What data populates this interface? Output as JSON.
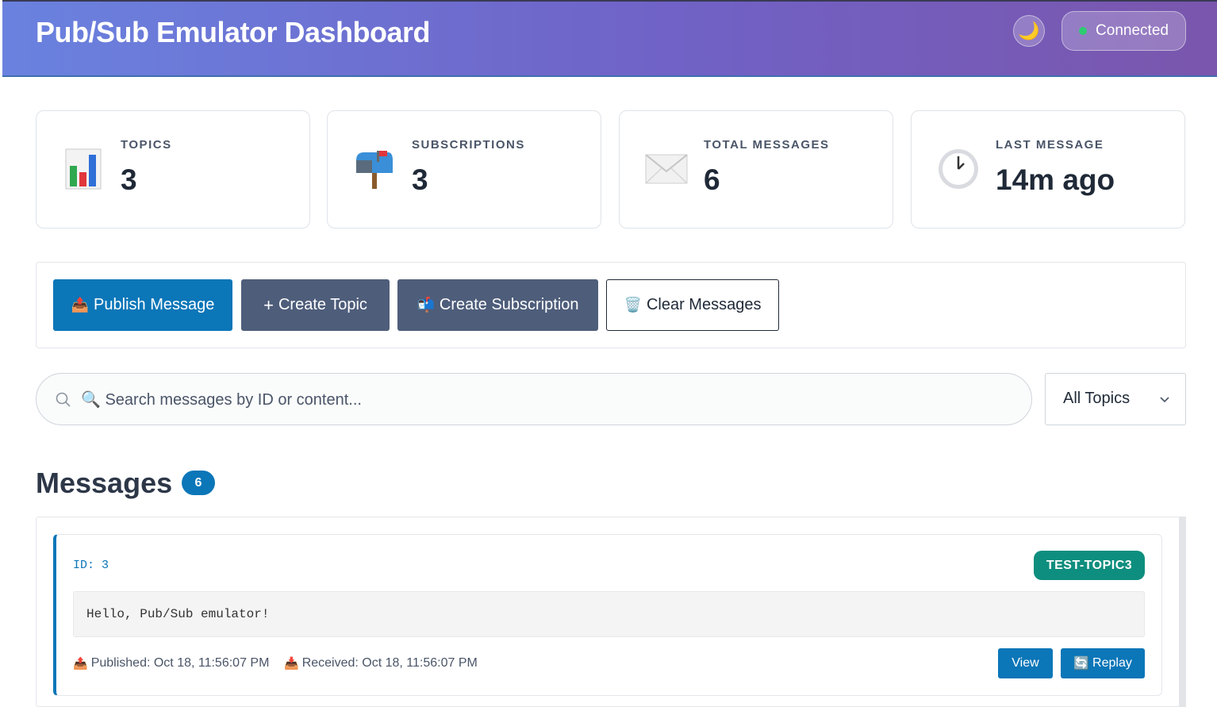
{
  "header": {
    "title": "Pub/Sub Emulator Dashboard",
    "theme_icon": "🌙",
    "status_label": "Connected",
    "status_color": "#2ecc71"
  },
  "stats": [
    {
      "label": "TOPICS",
      "value": "3",
      "icon": "📊"
    },
    {
      "label": "SUBSCRIPTIONS",
      "value": "3",
      "icon": "📬"
    },
    {
      "label": "TOTAL MESSAGES",
      "value": "6",
      "icon": "✉️"
    },
    {
      "label": "LAST MESSAGE",
      "value": "14m ago",
      "icon": "🕐"
    }
  ],
  "actions": {
    "publish": {
      "icon": "📤",
      "label": "Publish Message"
    },
    "create_topic": {
      "icon": "+",
      "label": "Create Topic"
    },
    "create_subscription": {
      "icon": "📬",
      "label": "Create Subscription"
    },
    "clear": {
      "icon": "🗑️",
      "label": "Clear Messages"
    }
  },
  "search": {
    "placeholder": "🔍 Search messages by ID or content..."
  },
  "filter": {
    "selected": "All Topics"
  },
  "messages": {
    "title": "Messages",
    "count": "6",
    "items": [
      {
        "id_label": "ID: 3",
        "topic": "TEST-TOPIC3",
        "body": "Hello, Pub/Sub emulator!",
        "published_icon": "📤",
        "published": "Published: Oct 18, 11:56:07 PM",
        "received_icon": "📥",
        "received": "Received: Oct 18, 11:56:07 PM",
        "view_label": "View",
        "replay_icon": "🔄",
        "replay_label": "Replay"
      }
    ]
  },
  "colors": {
    "primary": "#0b76b8",
    "slate": "#4e5d7a",
    "topic_badge": "#0e8e7e"
  }
}
